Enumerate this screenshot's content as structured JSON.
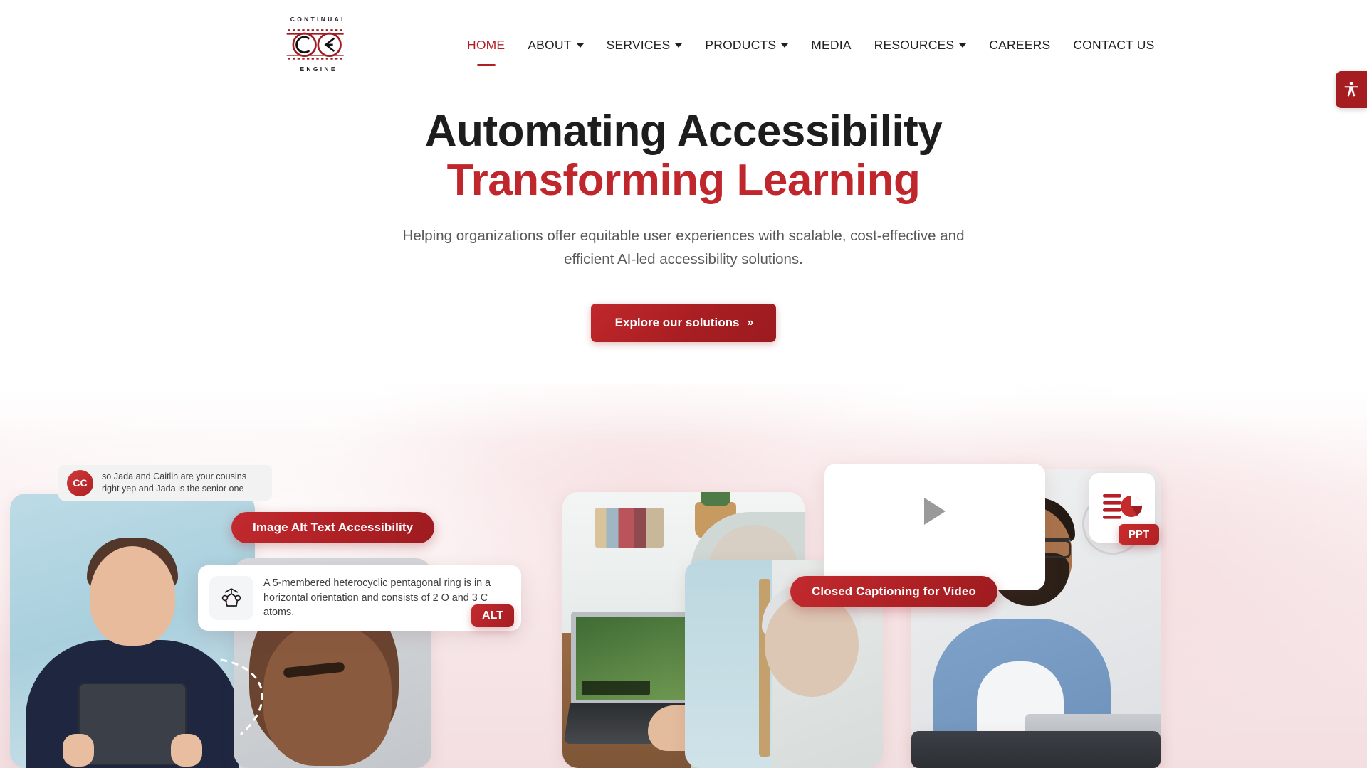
{
  "header": {
    "logo": {
      "top_word": "CONTINUAL",
      "bottom_word": "ENGINE",
      "icon": "infinity-ce-logo"
    },
    "nav": [
      {
        "label": "HOME",
        "has_dropdown": false,
        "active": true
      },
      {
        "label": "ABOUT",
        "has_dropdown": true,
        "active": false
      },
      {
        "label": "SERVICES",
        "has_dropdown": true,
        "active": false
      },
      {
        "label": "PRODUCTS",
        "has_dropdown": true,
        "active": false
      },
      {
        "label": "MEDIA",
        "has_dropdown": false,
        "active": false
      },
      {
        "label": "RESOURCES",
        "has_dropdown": true,
        "active": false
      },
      {
        "label": "CAREERS",
        "has_dropdown": false,
        "active": false
      },
      {
        "label": "CONTACT US",
        "has_dropdown": false,
        "active": false
      }
    ],
    "accessibility_widget": {
      "icon": "accessibility-person-icon"
    }
  },
  "hero": {
    "heading_line1": "Automating Accessibility",
    "heading_line2": "Transforming Learning",
    "subheading": "Helping organizations offer equitable user experiences with scalable, cost-effective and efficient AI-led accessibility solutions.",
    "cta_label": "Explore our solutions",
    "cta_chevron": "»"
  },
  "collage": {
    "alt_pill": "Image Alt Text Accessibility",
    "alt_description": "A 5-membered heterocyclic pentagonal ring is in a horizontal orientation and consists of 2 O and 3 C atoms.",
    "alt_badge": "ALT",
    "alt_thumb_icon": "chemical-structure-icon",
    "cc_pill": "Closed Captioning for Video",
    "cc_badge": "CC",
    "cc_caption": "so Jada and Caitlin are your cousins right yep and Jada is the senior one",
    "play_icon": "play-triangle-icon",
    "ppt_badge": "PPT",
    "ppt_icon": "presentation-document-icon"
  },
  "colors": {
    "brand_red": "#b01f24",
    "accent_red": "#c0272d",
    "heading_dark": "#1d1d1d",
    "body_gray": "#58585a"
  }
}
